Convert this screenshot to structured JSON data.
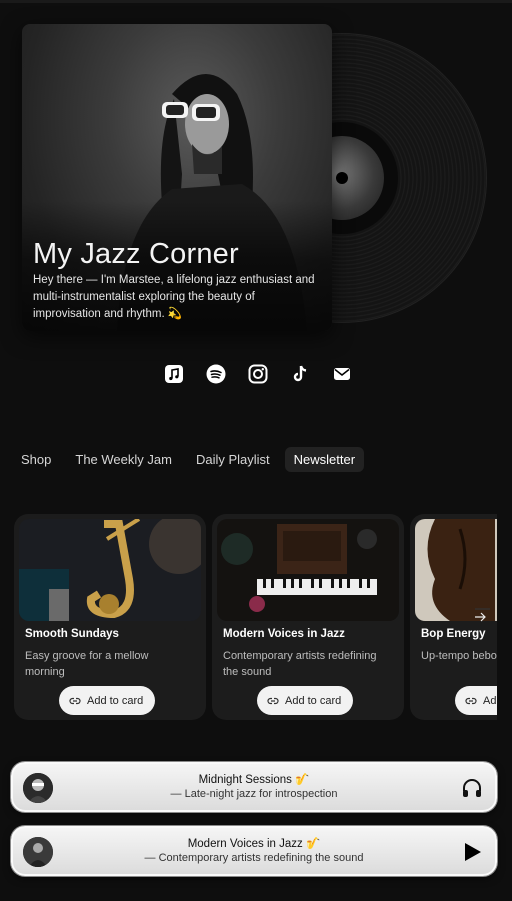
{
  "hero": {
    "title": "My Jazz Corner",
    "bio": "Hey there — I'm Marstee, a lifelong jazz enthusiast and multi-instrumentalist exploring the beauty of improvisation and rhythm. 💫"
  },
  "socials": [
    {
      "icon": "apple-music-icon"
    },
    {
      "icon": "spotify-icon"
    },
    {
      "icon": "instagram-icon"
    },
    {
      "icon": "tiktok-icon"
    },
    {
      "icon": "mail-icon"
    }
  ],
  "nav": {
    "tabs": [
      {
        "label": "Shop"
      },
      {
        "label": "The Weekly Jam"
      },
      {
        "label": "Daily Playlist"
      },
      {
        "label": "Newsletter",
        "active": true
      }
    ]
  },
  "cards": [
    {
      "title": "Smooth Sundays",
      "description": "Easy groove for a mellow morning",
      "button": "Add to card"
    },
    {
      "title": "Modern Voices in Jazz",
      "description": "Contemporary artists redefining the sound",
      "button": "Add to card"
    },
    {
      "title": "Bop Energy",
      "description": "Up-tempo bebop favorites",
      "button": "Add to card"
    }
  ],
  "players": [
    {
      "title": "Midnight Sessions 🎷",
      "subtitle": "— Late-night jazz for introspection",
      "control": "headphones-icon"
    },
    {
      "title": "Modern Voices in Jazz 🎷",
      "subtitle": "— Contemporary artists redefining the sound",
      "control": "play-icon"
    }
  ],
  "colors": {
    "background": "#0e0e0e",
    "card": "#1c1c1c",
    "active_tab": "#222222"
  }
}
